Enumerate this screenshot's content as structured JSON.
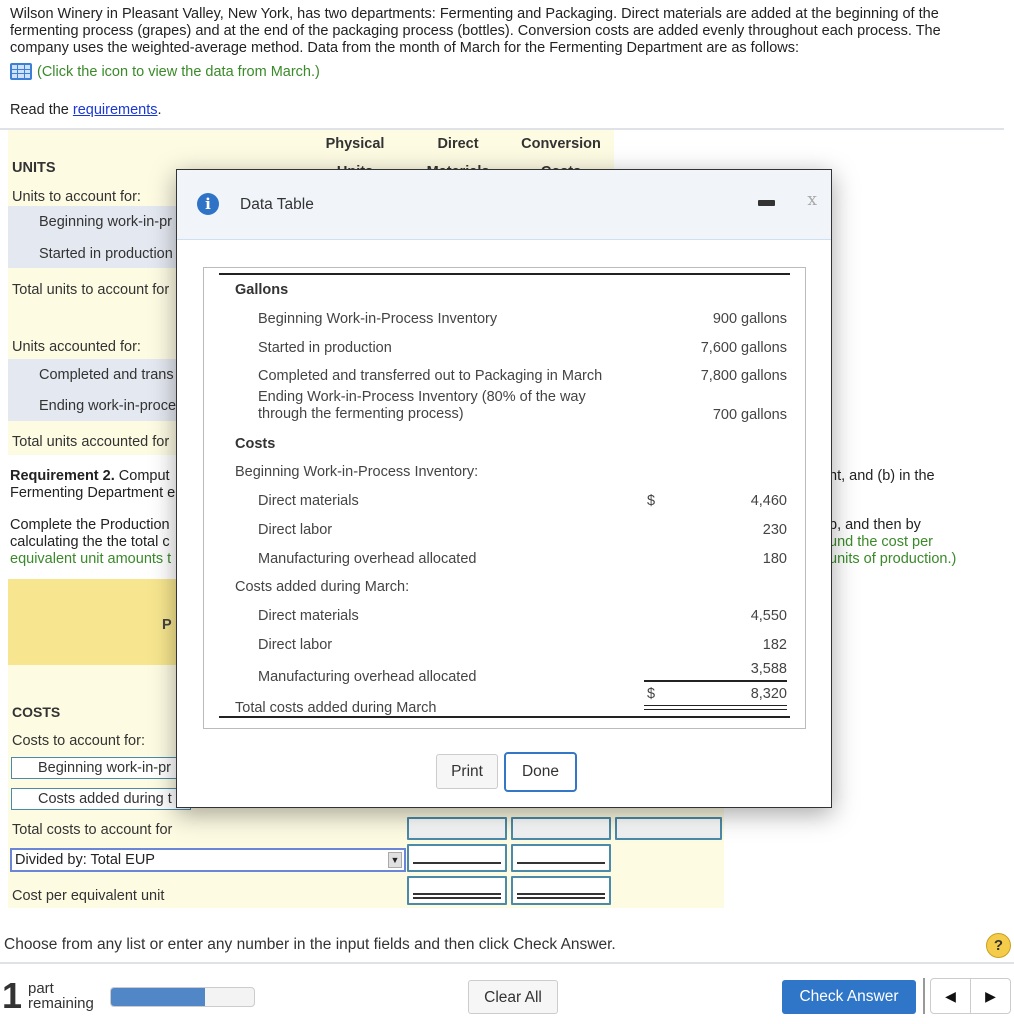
{
  "problem": {
    "intro": "Wilson Winery in Pleasant Valley, New York, has two departments: Fermenting and Packaging. Direct materials are added at the beginning of the fermenting process (grapes) and at the end of the packaging process (bottles). Conversion costs are added evenly throughout each process. The company uses the weighted-average method. Data from the month of March for the Fermenting Department are as follows:",
    "data_link": "(Click the icon to view the data from March.)",
    "read_prefix": "Read the ",
    "requirements_link": "requirements",
    "read_suffix": "."
  },
  "worksheet": {
    "col_headers": [
      {
        "line1": "Physical",
        "line2": "Units"
      },
      {
        "line1": "Direct",
        "line2": "Materials"
      },
      {
        "line1": "Conversion",
        "line2": "Costs"
      }
    ],
    "units_heading": "UNITS",
    "units_to_account": "Units to account for:",
    "beginning_wip": "Beginning work-in-pr",
    "started": "Started in production",
    "total_to_account": "Total units to account for",
    "units_accounted": "Units accounted for:",
    "completed": "Completed and trans",
    "ending_wip": "Ending work-in-proce",
    "total_accounted": "Total units accounted for",
    "req2_bold": "Requirement 2.",
    "req2_text": " Comput",
    "req2_line2": "Fermenting Department e",
    "req2_right": "nt, and (b) in the",
    "complete_line1": "Complete the Production",
    "complete_line2": "calculating the the total c",
    "complete_line3": "equivalent unit amounts t",
    "complete_right1": "p, and then by",
    "complete_right2": "und the cost per",
    "complete_right3": "units of production.)",
    "yellow_header_partial": "P",
    "costs_heading": "COSTS",
    "costs_to_account": "Costs to account for:",
    "cost_beginning_wip": "Beginning work-in-pr",
    "cost_added": "Costs added during t",
    "total_costs": "Total costs to account for",
    "divided_by_select": "Divided by: Total EUP",
    "cost_per_eu": "Cost per equivalent unit"
  },
  "modal": {
    "title": "Data Table",
    "gallons_heading": "Gallons",
    "gallons_rows": [
      {
        "label": "Beginning Work-in-Process Inventory",
        "value": "900 gallons"
      },
      {
        "label": "Started in production",
        "value": "7,600 gallons"
      },
      {
        "label": "Completed and transferred out to Packaging in March",
        "value": "7,800 gallons"
      },
      {
        "label_line1": "Ending Work-in-Process Inventory (80% of the way",
        "label_line2": "through the fermenting process)",
        "value": "700 gallons"
      }
    ],
    "costs_heading": "Costs",
    "bwip_heading": "Beginning Work-in-Process Inventory:",
    "bwip_rows": [
      {
        "label": "Direct materials",
        "dollar": "$",
        "value": "4,460"
      },
      {
        "label": "Direct labor",
        "value": "230"
      },
      {
        "label": "Manufacturing overhead allocated",
        "value": "180"
      }
    ],
    "added_heading": "Costs added during March:",
    "added_rows": [
      {
        "label": "Direct materials",
        "value": "4,550"
      },
      {
        "label": "Direct labor",
        "value": "182"
      },
      {
        "label": "Manufacturing overhead allocated",
        "value": "3,588"
      }
    ],
    "total_label": "Total costs added during March",
    "total_dollar": "$",
    "total_value": "8,320",
    "print_label": "Print",
    "done_label": "Done"
  },
  "footer": {
    "instruction": "Choose from any list or enter any number in the input fields and then click Check Answer.",
    "help": "?",
    "parts_count": "1",
    "parts_word1": "part",
    "parts_word2": "remaining",
    "progress_fraction": 0.66,
    "clear_all": "Clear All",
    "check_answer": "Check Answer",
    "prev": "◀",
    "next": "▶"
  }
}
